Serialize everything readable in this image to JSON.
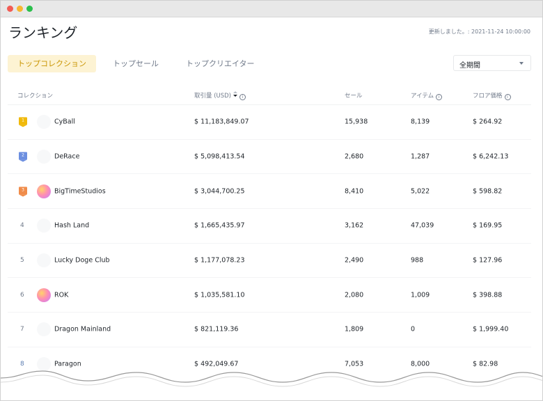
{
  "page": {
    "title": "ランキング",
    "updated": "更新しました。: 2021-11-24 10:00:00"
  },
  "tabs": [
    {
      "label": "トップコレクション",
      "active": true
    },
    {
      "label": "トップセール",
      "active": false
    },
    {
      "label": "トップクリエイター",
      "active": false
    }
  ],
  "period_select": {
    "value": "全期間"
  },
  "table": {
    "columns": {
      "collection": "コレクション",
      "volume": "取引量 (USD)",
      "sales": "セール",
      "items": "アイテム",
      "floor": "フロア価格"
    },
    "rows": [
      {
        "rank": "1",
        "name": "CyBall",
        "volume": "$ 11,183,849.07",
        "sales": "15,938",
        "items": "8,139",
        "floor": "$ 264.92"
      },
      {
        "rank": "2",
        "name": "DeRace",
        "volume": "$ 5,098,413.54",
        "sales": "2,680",
        "items": "1,287",
        "floor": "$ 6,242.13"
      },
      {
        "rank": "3",
        "name": "BigTimeStudios",
        "volume": "$ 3,044,700.25",
        "sales": "8,410",
        "items": "5,022",
        "floor": "$ 598.82"
      },
      {
        "rank": "4",
        "name": "Hash Land",
        "volume": "$ 1,665,435.97",
        "sales": "3,162",
        "items": "47,039",
        "floor": "$ 169.95"
      },
      {
        "rank": "5",
        "name": "Lucky Doge Club",
        "volume": "$ 1,177,078.23",
        "sales": "2,490",
        "items": "988",
        "floor": "$ 127.96"
      },
      {
        "rank": "6",
        "name": "ROK",
        "volume": "$ 1,035,581.10",
        "sales": "2,080",
        "items": "1,009",
        "floor": "$ 398.88"
      },
      {
        "rank": "7",
        "name": "Dragon Mainland",
        "volume": "$ 821,119.36",
        "sales": "1,809",
        "items": "0",
        "floor": "$ 1,999.40"
      },
      {
        "rank": "8",
        "name": "Paragon",
        "volume": "$ 492,049.67",
        "sales": "7,053",
        "items": "8,000",
        "floor": "$ 82.98"
      }
    ]
  },
  "colors": {
    "accent": "#c99400",
    "accent_bg": "#fdf3d3",
    "medal_gold": "#f0b90b",
    "medal_silver": "#6c8fe0",
    "medal_bronze": "#f08c4a"
  }
}
